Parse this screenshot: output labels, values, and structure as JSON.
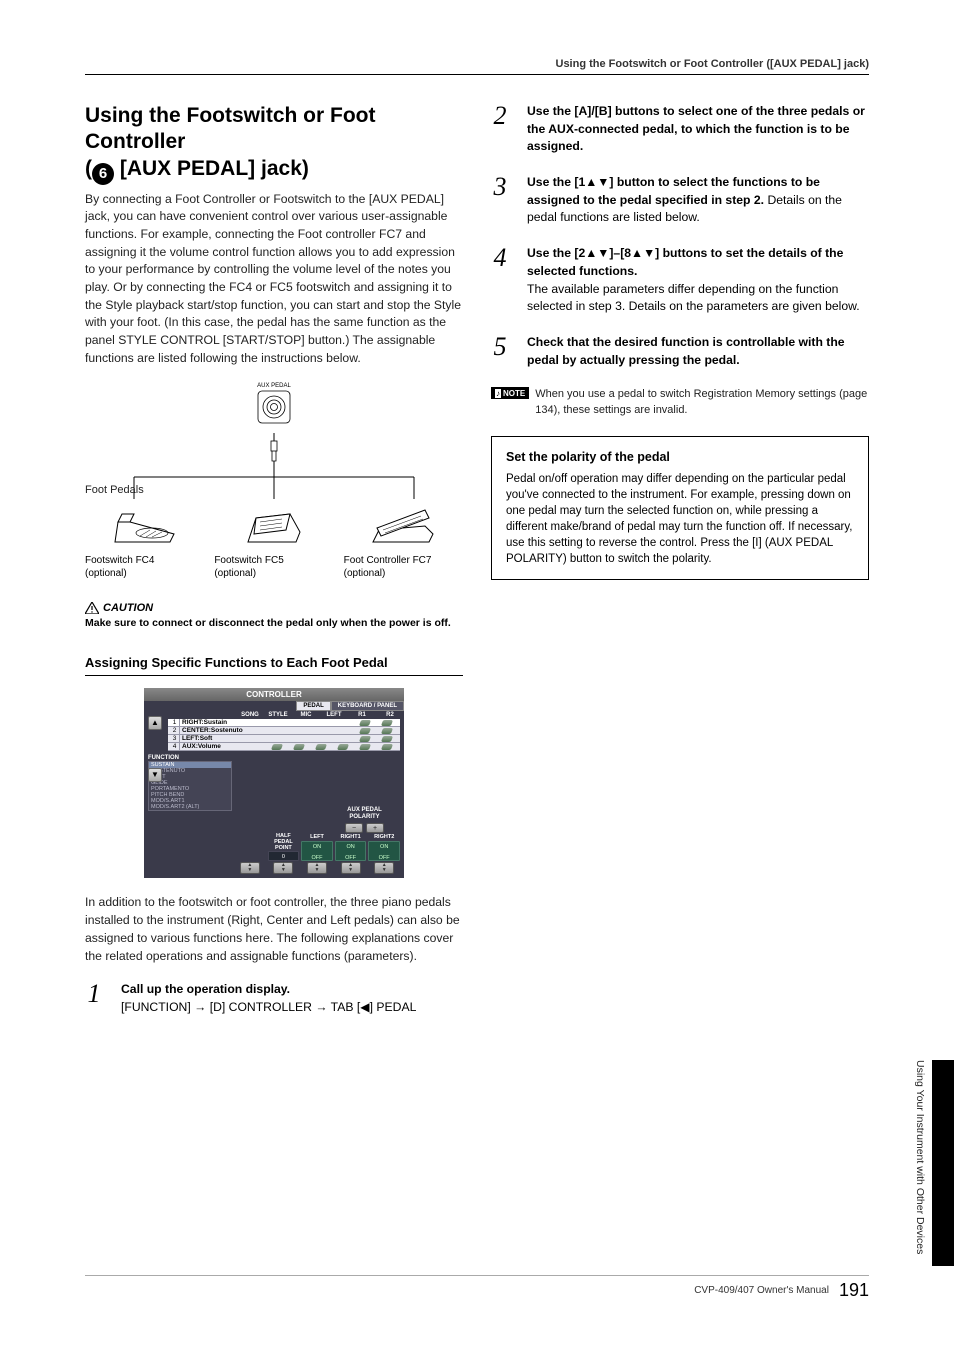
{
  "running_head": "Using the Footswitch or Foot Controller ([AUX PEDAL] jack)",
  "title": {
    "line1": "Using the Footswitch or Foot Controller",
    "line2_prefix": "(",
    "line2_num": "6",
    "line2_suffix": " [AUX PEDAL] jack)"
  },
  "intro": "By connecting a Foot Controller or Footswitch to the [AUX PEDAL] jack, you can have convenient control over various user-assignable functions. For example, connecting the Foot controller FC7 and assigning it the volume control function allows you to add expression to your performance by controlling the volume level of the notes you play. Or by connecting the FC4 or FC5 footswitch and assigning it to the Style playback start/stop function, you can start and stop the Style with your foot. (In this case, the pedal has the same function as the panel STYLE CONTROL [START/STOP] button.) The assignable functions are listed following the instructions below.",
  "diagram": {
    "jack_label": "AUX PEDAL",
    "foot_pedals_label": "Foot Pedals",
    "pedals": [
      {
        "name": "Footswitch FC4",
        "opt": "(optional)"
      },
      {
        "name": "Footswitch FC5",
        "opt": "(optional)"
      },
      {
        "name": "Foot Controller FC7",
        "opt": "(optional)"
      }
    ]
  },
  "caution": {
    "heading": "CAUTION",
    "text": "Make sure to connect or disconnect the pedal only when the power is off."
  },
  "subsection_heading": "Assigning Specific Functions to Each Foot Pedal",
  "screen": {
    "title": "CONTROLLER",
    "tabs": {
      "active": "PEDAL",
      "other": "KEYBOARD / PANEL"
    },
    "cols": [
      "SONG",
      "STYLE",
      "MIC",
      "LEFT",
      "R1",
      "R2"
    ],
    "rows": [
      {
        "num": "1",
        "label": "RIGHT:Sustain",
        "ticks": [
          0,
          0,
          0,
          0,
          1,
          1
        ]
      },
      {
        "num": "2",
        "label": "CENTER:Sostenuto",
        "ticks": [
          0,
          0,
          0,
          0,
          1,
          1
        ]
      },
      {
        "num": "3",
        "label": "LEFT:Soft",
        "ticks": [
          0,
          0,
          0,
          0,
          1,
          1
        ]
      },
      {
        "num": "4",
        "label": "AUX:Volume",
        "ticks": [
          1,
          1,
          1,
          1,
          1,
          1
        ]
      }
    ],
    "func_label": "FUNCTION",
    "func_list": [
      "SUSTAIN",
      "SOSTENUTO",
      "SOFT",
      "GLIDE",
      "PORTAMENTO",
      "PITCH BEND",
      "MOD/S.ART1",
      "MOD/S.ART2 (ALT)"
    ],
    "aux_polarity_label": "AUX PEDAL\nPOLARITY",
    "aux_polarity_minus": "−",
    "aux_polarity_plus": "+",
    "bottom_params": [
      {
        "label": "",
        "value": ""
      },
      {
        "label": "HALF PEDAL POINT",
        "value": "0"
      },
      {
        "label": "LEFT",
        "on": "ON",
        "off": "OFF"
      },
      {
        "label": "RIGHT1",
        "on": "ON",
        "off": "OFF"
      },
      {
        "label": "RIGHT2",
        "on": "ON",
        "off": "OFF"
      }
    ]
  },
  "followup": "In addition to the footswitch or foot controller, the three piano pedals installed to the instrument (Right, Center and Left pedals) can also be assigned to various functions here. The following explanations cover the related operations and assignable functions (parameters).",
  "steps": [
    {
      "num": "1",
      "bold": "Call up the operation display.",
      "normal": "[FUNCTION] → [D] CONTROLLER → TAB [◀] PEDAL"
    },
    {
      "num": "2",
      "bold": "Use the [A]/[B] buttons to select one of the three pedals or the AUX-connected pedal, to which the function is to be assigned.",
      "normal": ""
    },
    {
      "num": "3",
      "bold": "Use the [1▲▼] button to select the functions to be assigned to the pedal specified in step 2.",
      "normal": "Details on the pedal functions are listed below."
    },
    {
      "num": "4",
      "bold": "Use the [2▲▼]–[8▲▼] buttons to set the details of the selected functions.",
      "normal": "The available parameters differ depending on the function selected in step 3. Details on the parameters are given below."
    },
    {
      "num": "5",
      "bold": "Check that the desired function is controllable with the pedal by actually pressing the pedal.",
      "normal": ""
    }
  ],
  "note": {
    "badge": "NOTE",
    "text": "When you use a pedal to switch Registration Memory settings (page 134), these settings are invalid."
  },
  "polarity_box": {
    "heading": "Set the polarity of the pedal",
    "body": "Pedal on/off operation may differ depending on the particular pedal you've connected to the instrument. For example, pressing down on one pedal may turn the selected function on, while pressing a different make/brand of pedal may turn the function off. If necessary, use this setting to reverse the control. Press the [I] (AUX PEDAL POLARITY) button to switch the polarity."
  },
  "side_text": "Using Your Instrument with Other Devices",
  "footer": {
    "manual": "CVP-409/407 Owner's Manual",
    "pagenum": "191"
  }
}
